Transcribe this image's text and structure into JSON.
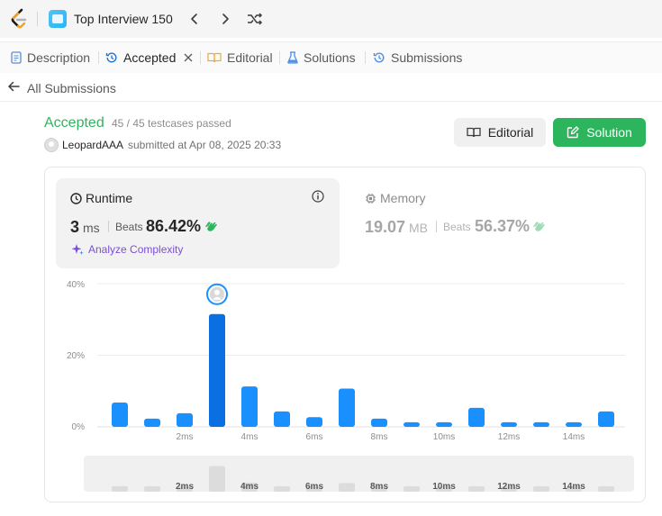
{
  "topbar": {
    "study_title": "Top Interview 150"
  },
  "tabs": [
    {
      "label": "Description",
      "icon": "description-icon"
    },
    {
      "label": "Accepted",
      "icon": "history-icon"
    },
    {
      "label": "Editorial",
      "icon": "book-icon"
    },
    {
      "label": "Solutions",
      "icon": "flask-icon"
    },
    {
      "label": "Submissions",
      "icon": "history-icon"
    }
  ],
  "back": {
    "label": "All Submissions"
  },
  "submission": {
    "status": "Accepted",
    "passed": "45 / 45 testcases passed",
    "username": "LeopardAAA",
    "submitted": "submitted at Apr 08, 2025 20:33"
  },
  "buttons": {
    "editorial": "Editorial",
    "solution": "Solution"
  },
  "runtime": {
    "title": "Runtime",
    "value": "3",
    "unit": "ms",
    "beats_label": "Beats",
    "beats_value": "86.42%",
    "analyze": "Analyze Complexity"
  },
  "memory": {
    "title": "Memory",
    "value": "19.07",
    "unit": "MB",
    "beats_label": "Beats",
    "beats_value": "56.37%"
  },
  "colors": {
    "accent": "#2db55d",
    "bar": "#1a90ff",
    "bar_selected": "#0a6fe0"
  },
  "chart_data": {
    "type": "bar",
    "x": [
      1,
      2,
      3,
      4,
      5,
      6,
      7,
      8,
      9,
      10,
      11,
      12,
      13,
      14,
      15,
      16
    ],
    "values": [
      6.8,
      2.3,
      3.8,
      31.5,
      11.3,
      4.3,
      2.7,
      10.7,
      2.3,
      1.3,
      1.3,
      5.3,
      1.3,
      1.3,
      1.3,
      4.3
    ],
    "selected_x": 4,
    "xticks": [
      "2ms",
      "4ms",
      "6ms",
      "8ms",
      "10ms",
      "12ms",
      "14ms"
    ],
    "xtick_values": [
      3,
      5,
      7,
      9,
      11,
      13,
      15
    ],
    "yticks": [
      "0%",
      "20%",
      "40%"
    ],
    "ylim": [
      0,
      40
    ]
  }
}
